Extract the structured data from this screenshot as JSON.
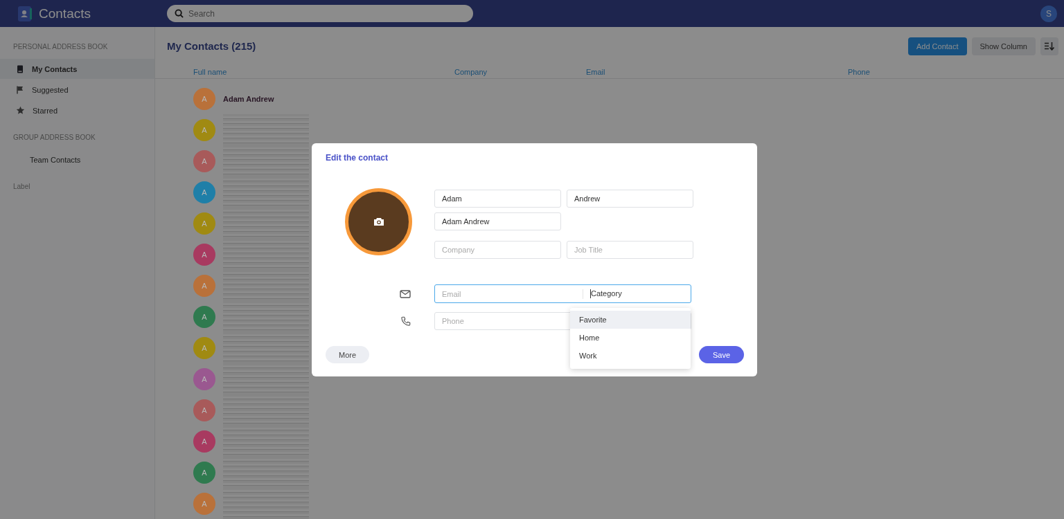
{
  "app": {
    "title": "Contacts",
    "search_placeholder": "Search",
    "user_initial": "S"
  },
  "sidebar": {
    "sections": [
      {
        "heading": "PERSONAL ADDRESS BOOK",
        "items": [
          {
            "label": "My Contacts",
            "selected": true
          },
          {
            "label": "Suggested",
            "selected": false
          },
          {
            "label": "Starred",
            "selected": false
          }
        ]
      },
      {
        "heading": "GROUP ADDRESS BOOK",
        "items": [
          {
            "label": "Team Contacts",
            "selected": false
          }
        ]
      },
      {
        "heading": "Label"
      }
    ]
  },
  "main": {
    "title": "My Contacts (215)",
    "buttons": [
      {
        "label": "Add Contact",
        "kind": "primary"
      },
      {
        "label": "Show Column",
        "kind": "secondary"
      }
    ],
    "columns": [
      "Full name",
      "Company",
      "Email",
      "Phone"
    ],
    "rows": [
      {
        "initial": "A",
        "color": "#b9713a",
        "name": "Adam Andrew",
        "redacted": false
      },
      {
        "initial": "A",
        "color": "#a08a12",
        "redacted": true
      },
      {
        "initial": "A",
        "color": "#a85a5a",
        "redacted": true
      },
      {
        "initial": "A",
        "color": "#1f7fa8",
        "redacted": true
      },
      {
        "initial": "A",
        "color": "#a08a12",
        "redacted": true
      },
      {
        "initial": "A",
        "color": "#a83a60",
        "redacted": true
      },
      {
        "initial": "A",
        "color": "#b9713a",
        "redacted": true
      },
      {
        "initial": "A",
        "color": "#2f7a4f",
        "redacted": true
      },
      {
        "initial": "A",
        "color": "#a08a12",
        "redacted": true
      },
      {
        "initial": "A",
        "color": "#9a5890",
        "redacted": true
      },
      {
        "initial": "A",
        "color": "#a85a5a",
        "redacted": true
      },
      {
        "initial": "A",
        "color": "#a83a60",
        "redacted": true
      },
      {
        "initial": "A",
        "color": "#2f7a4f",
        "redacted": true
      },
      {
        "initial": "A",
        "color": "#b9713a",
        "redacted": true
      }
    ]
  },
  "dialog": {
    "title": "Edit the contact",
    "name_fields": [
      {
        "value": "Adam"
      },
      {
        "value": "Andrew"
      },
      {
        "value": "Adam Andrew"
      }
    ],
    "work_fields": [
      {
        "placeholder": "Company"
      },
      {
        "placeholder": "Job Title"
      }
    ],
    "email": {
      "placeholder": "Email",
      "category": "Category",
      "focused": true
    },
    "phone": {
      "placeholder": "Phone"
    },
    "category_options": [
      {
        "label": "Favorite",
        "selected": true
      },
      {
        "label": "Home",
        "selected": false
      },
      {
        "label": "Work",
        "selected": false
      }
    ],
    "buttons": [
      {
        "label": "More",
        "kind": "secondary"
      },
      {
        "label": "Save",
        "kind": "primary"
      }
    ]
  }
}
